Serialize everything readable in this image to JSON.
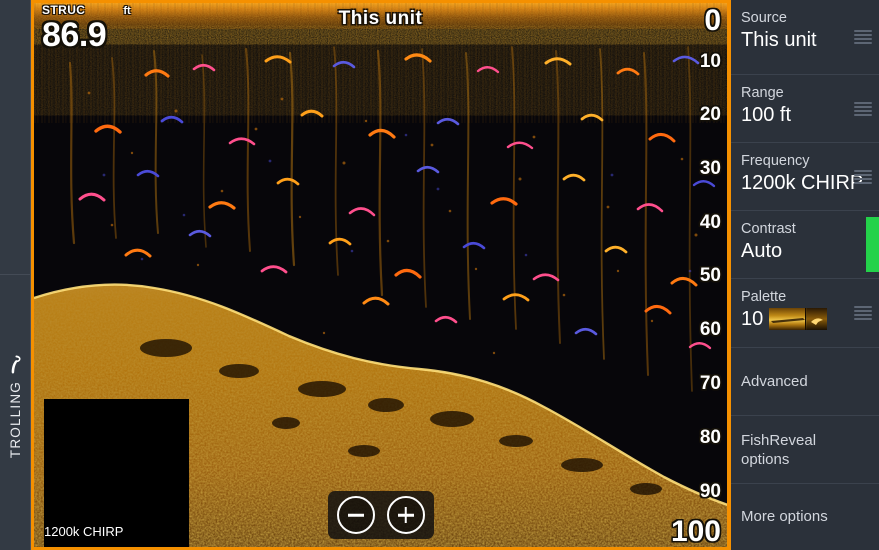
{
  "app": {
    "accent_orange": "#f59000",
    "panel_bg": "#2b313a",
    "contrast_indicator_color": "#24d24a"
  },
  "left_rail": {
    "mode_label": "TROLLING",
    "mode_icon": "trolling-motor-icon"
  },
  "sonar": {
    "title": "This unit",
    "overlay": {
      "tag": "STRUC",
      "unit": "ft",
      "depth_value": "86.9"
    },
    "frequency_label": "1200k CHIRP",
    "depth_scale": {
      "unit": "ft",
      "ticks": [
        "0",
        "10",
        "20",
        "30",
        "40",
        "50",
        "60",
        "70",
        "80",
        "90",
        "100"
      ]
    },
    "zoom_controls": {
      "zoom_out_label": "−",
      "zoom_in_label": "+"
    }
  },
  "menu": {
    "items": [
      {
        "label": "Source",
        "value": "This unit",
        "icon": "slider-grip-icon"
      },
      {
        "label": "Range",
        "value": "100 ft",
        "icon": "slider-grip-icon"
      },
      {
        "label": "Frequency",
        "value": "1200k CHIRP",
        "icon": "slider-grip-icon"
      },
      {
        "label": "Contrast",
        "value": "Auto",
        "icon": "contrast-level-bar"
      },
      {
        "label": "Palette",
        "value": "10",
        "icon": "palette-swatch-icon"
      },
      {
        "label": "Advanced",
        "value": "",
        "icon": ""
      },
      {
        "label": "FishReveal\noptions",
        "label_line1": "FishReveal",
        "label_line2": "options",
        "value": "",
        "icon": ""
      },
      {
        "label": "More options",
        "value": "",
        "icon": ""
      }
    ]
  }
}
